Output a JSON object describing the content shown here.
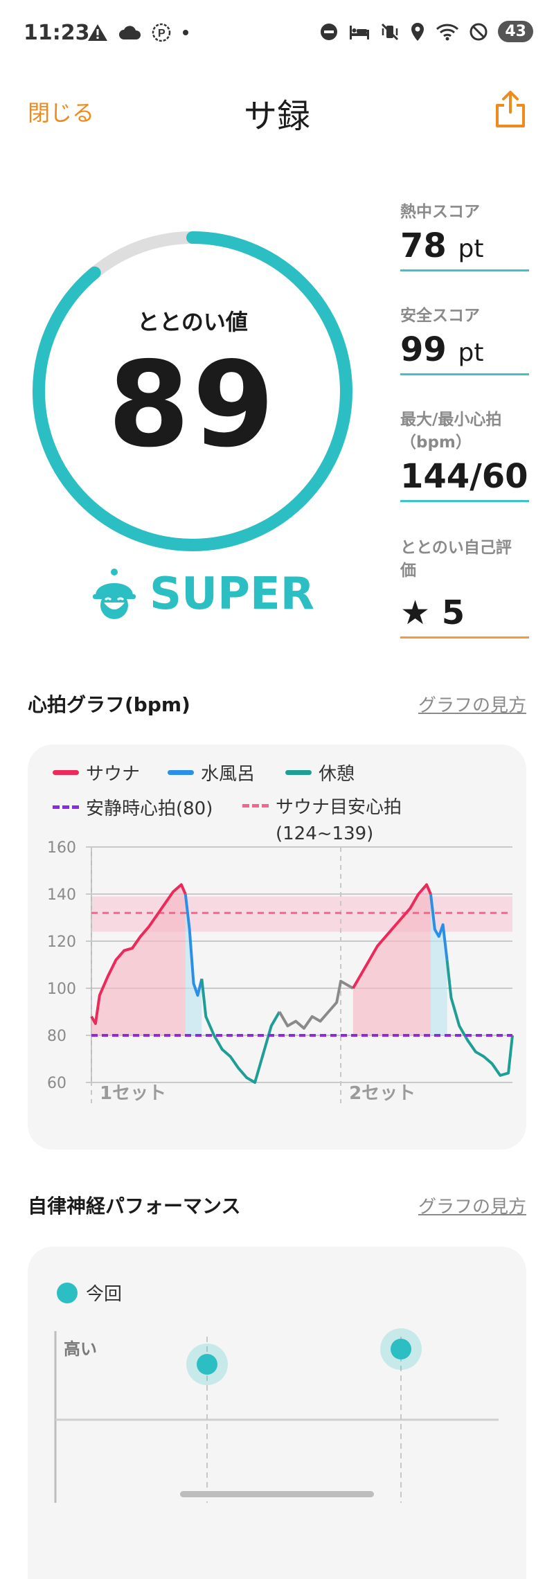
{
  "status_bar": {
    "time": "11:23",
    "battery": "43"
  },
  "header": {
    "close_label": "閉じる",
    "title": "サ録"
  },
  "score": {
    "label": "ととのい値",
    "value": "89",
    "grade": "SUPER",
    "progress_percent": 89
  },
  "stats": [
    {
      "label": "熱中スコア",
      "value": "78",
      "unit": "pt"
    },
    {
      "label": "安全スコア",
      "value": "99",
      "unit": "pt"
    },
    {
      "label_line1": "最大/最小心拍",
      "label_line2": "（bpm）",
      "value": "144/60"
    },
    {
      "label_line1": "ととのい自己評",
      "label_line2": "価",
      "star": "★",
      "value": "5"
    }
  ],
  "heart_graph": {
    "title": "心拍グラフ(bpm)",
    "help_link": "グラフの見方",
    "legend": {
      "sauna": "サウナ",
      "cold_bath": "水風呂",
      "rest": "休憩",
      "resting_hr": "安静時心拍(80)",
      "target_line1": "サウナ目安心拍",
      "target_line2": "(124~139)"
    },
    "set_labels": [
      "1セット",
      "2セット"
    ]
  },
  "autonomic": {
    "title": "自律神経パフォーマンス",
    "help_link": "グラフの見方",
    "legend_current": "今回",
    "y_label_high": "高い"
  },
  "colors": {
    "accent": "#2bbfc4",
    "sauna": "#ec2a5a",
    "cold_bath": "#2a8fe6",
    "rest": "#1f9e96",
    "resting_line": "#8a2be2",
    "target_line": "#f0688c",
    "link_orange": "#ee8b1c"
  },
  "chart_data": {
    "type": "line",
    "title": "心拍グラフ(bpm)",
    "ylim": [
      60,
      160
    ],
    "yticks": [
      60,
      80,
      100,
      120,
      140,
      160
    ],
    "resting_hr": 80,
    "target_range": [
      124,
      139
    ],
    "target_mid": 132,
    "series": [
      {
        "name": "サウナ",
        "points": [
          [
            0,
            88
          ],
          [
            0.5,
            85
          ],
          [
            1,
            97
          ],
          [
            2,
            105
          ],
          [
            3,
            112
          ],
          [
            4,
            116
          ],
          [
            5,
            117
          ],
          [
            6,
            122
          ],
          [
            7,
            126
          ],
          [
            8,
            131
          ],
          [
            9,
            136
          ],
          [
            10,
            141
          ],
          [
            11,
            144
          ],
          [
            11.5,
            140
          ]
        ]
      },
      {
        "name": "水風呂",
        "points": [
          [
            11.5,
            140
          ],
          [
            12,
            125
          ],
          [
            12.5,
            102
          ],
          [
            13,
            97
          ],
          [
            13.5,
            104
          ]
        ]
      },
      {
        "name": "休憩",
        "points": [
          [
            13.5,
            104
          ],
          [
            14,
            88
          ],
          [
            15,
            80
          ],
          [
            16,
            74
          ],
          [
            17,
            71
          ],
          [
            18,
            66
          ],
          [
            19,
            62
          ],
          [
            20,
            60
          ],
          [
            21,
            72
          ],
          [
            22,
            84
          ],
          [
            23,
            90
          ]
        ]
      },
      {
        "name": "",
        "points": [
          [
            23,
            90
          ],
          [
            24,
            84
          ],
          [
            25,
            86
          ],
          [
            26,
            83
          ],
          [
            27,
            88
          ],
          [
            28,
            86
          ],
          [
            29,
            90
          ],
          [
            30,
            94
          ],
          [
            30.5,
            103
          ],
          [
            31,
            102
          ],
          [
            32,
            100
          ]
        ]
      },
      {
        "name": "サウナ",
        "points": [
          [
            32,
            100
          ],
          [
            33,
            106
          ],
          [
            34,
            112
          ],
          [
            35,
            118
          ],
          [
            36,
            122
          ],
          [
            37,
            126
          ],
          [
            38,
            130
          ],
          [
            39,
            134
          ],
          [
            40,
            140
          ],
          [
            41,
            144
          ],
          [
            41.5,
            140
          ]
        ]
      },
      {
        "name": "水風呂",
        "points": [
          [
            41.5,
            140
          ],
          [
            42,
            125
          ],
          [
            42.5,
            122
          ],
          [
            43,
            127
          ],
          [
            43.5,
            112
          ]
        ]
      },
      {
        "name": "休憩",
        "points": [
          [
            43.5,
            112
          ],
          [
            44,
            96
          ],
          [
            45,
            84
          ],
          [
            46,
            78
          ],
          [
            47,
            73
          ],
          [
            48,
            71
          ],
          [
            49,
            68
          ],
          [
            50,
            63
          ],
          [
            51,
            64
          ],
          [
            51.5,
            80
          ]
        ]
      }
    ],
    "set_start_x": [
      0,
      30.5
    ]
  }
}
